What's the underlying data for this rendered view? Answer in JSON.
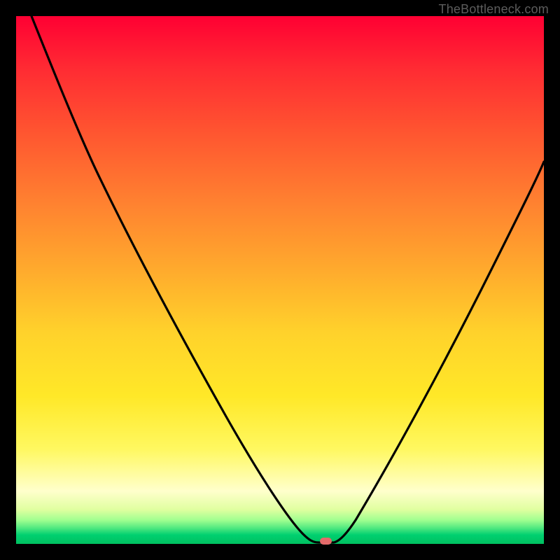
{
  "watermark": "TheBottleneck.com",
  "chart_data": {
    "type": "line",
    "title": "",
    "xlabel": "",
    "ylabel": "",
    "xlim": [
      0,
      100
    ],
    "ylim": [
      0,
      100
    ],
    "series": [
      {
        "name": "bottleneck-curve",
        "x": [
          3,
          8,
          15,
          22,
          30,
          38,
          45,
          50,
          53,
          55,
          57,
          60,
          64,
          70,
          78,
          86,
          94,
          100
        ],
        "y": [
          100,
          89,
          74,
          61,
          47,
          33,
          20,
          11,
          5,
          1,
          0,
          0,
          4,
          14,
          30,
          48,
          66,
          79
        ]
      }
    ],
    "marker": {
      "x": 58.5,
      "y": 0
    },
    "gradient_stops": [
      {
        "pos": 0,
        "color": "#ff0033"
      },
      {
        "pos": 0.5,
        "color": "#ffd22b"
      },
      {
        "pos": 0.9,
        "color": "#ffffcc"
      },
      {
        "pos": 1.0,
        "color": "#00c060"
      }
    ]
  }
}
